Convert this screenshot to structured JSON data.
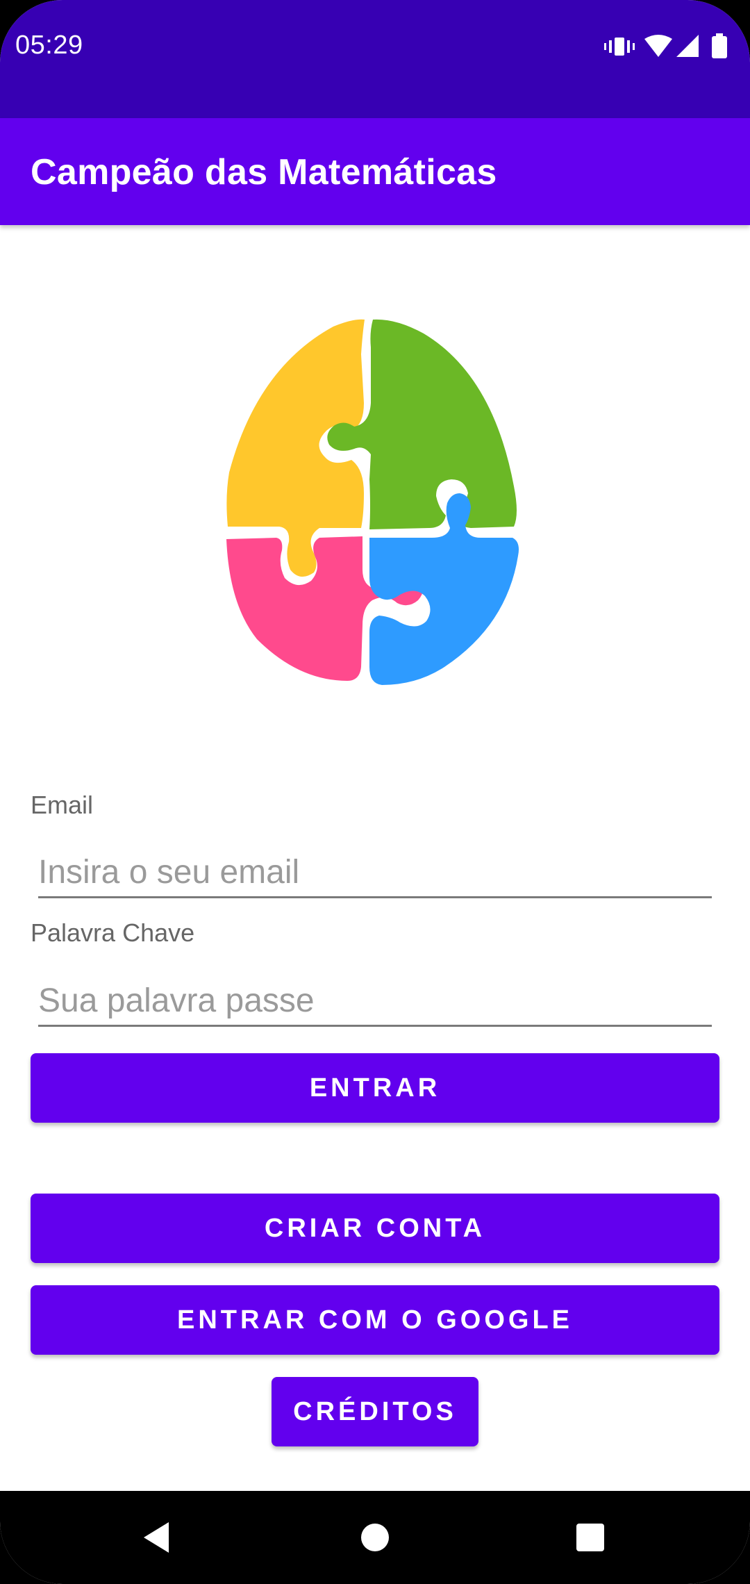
{
  "status_bar": {
    "time": "05:29",
    "icons": [
      "vibrate-icon",
      "wifi-icon",
      "cell-signal-icon",
      "battery-icon"
    ]
  },
  "app_bar": {
    "title": "Campeão das Matemáticas"
  },
  "logo": {
    "icon": "puzzle-brain-icon",
    "colors": [
      "#FFC72C",
      "#6BB826",
      "#FF4A8D",
      "#2E9BFF"
    ]
  },
  "form": {
    "email": {
      "label": "Email",
      "placeholder": "Insira o seu email",
      "value": ""
    },
    "password": {
      "label": "Palavra Chave",
      "placeholder": "Sua palavra passe",
      "value": ""
    }
  },
  "buttons": {
    "login": "ENTRAR",
    "create_account": "CRIAR CONTA",
    "google": "ENTRAR COM O GOOGLE",
    "credits": "CRÉDITOS"
  },
  "nav": {
    "icons": [
      "back-icon",
      "home-icon",
      "recents-icon"
    ]
  },
  "colors": {
    "status_bar": "#3700B3",
    "primary": "#6200EE",
    "background": "#FFFFFF"
  }
}
